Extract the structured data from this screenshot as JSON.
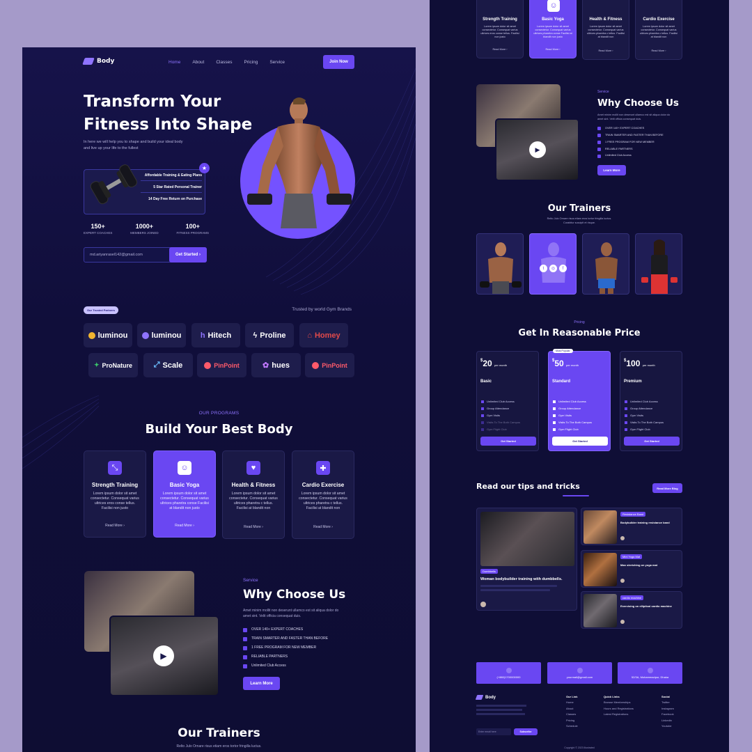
{
  "brand": {
    "name": "Body"
  },
  "nav": {
    "items": [
      "Home",
      "About",
      "Classes",
      "Pricing",
      "Service"
    ],
    "cta": "Join Now"
  },
  "hero": {
    "title_line1": "Transform Your",
    "title_line2": "Fitness Into Shape",
    "subtitle_line1": "In here we will help you to shape and build your ideal body",
    "subtitle_line2": "and live up your life to the fullest",
    "features": [
      "Affordable Training & Eating Plans",
      "5 Star Rated Personal Trainer",
      "14 Day Free Return on Purchase"
    ],
    "stats": [
      {
        "value": "150+",
        "label": "EXPERT COACHES"
      },
      {
        "value": "1000+",
        "label": "MEMBERS JOINED"
      },
      {
        "value": "100+",
        "label": "FITNESS PROGRAMS"
      }
    ],
    "email_value": "md.ariyanrasel142@gmail.com",
    "cta": "Get Started"
  },
  "trusted": {
    "badge": "Our Trusted Partners",
    "text": "Trusted by world Gym Brands",
    "brands_row1": [
      "luminou",
      "luminou",
      "Hitech",
      "Proline",
      "Homey"
    ],
    "brands_row2": [
      "ProNature",
      "Scale",
      "PinPoint",
      "hues",
      "PinPoint"
    ]
  },
  "programs": {
    "eyebrow": "OUR PROGRAMS",
    "title": "Build Your Best Body",
    "cards": [
      {
        "title": "Strength Training",
        "desc": "Lorem ipsum dolor sit amet consectetur. Consequat varius ultrices eros conse tellus. Facilisi non justo",
        "more": "Read More"
      },
      {
        "title": "Basic Yoga",
        "desc": "Lorem ipsum dolor sit amet consectetur. Consequat varius ultrices pharetra conse Facilisi at blandit non justo",
        "more": "Read More"
      },
      {
        "title": "Health & Fitness",
        "desc": "Lorem ipsum dolor sit amet consectetur. Consequat varius ultrices pharetra c tellus. Facilisi at blandit non",
        "more": "Read More"
      },
      {
        "title": "Cardio Exercise",
        "desc": "Lorem ipsum dolor sit amet consectetur. Consequat varius ultrices pharetra c tellus. Facilisi at blandit non",
        "more": "Read More"
      }
    ]
  },
  "why": {
    "eyebrow": "Service",
    "title": "Why Choose Us",
    "desc_line1": "Amet minim mollit non deserunt ullamco est sit aliqua dolor do",
    "desc_line2": "amet sint. Velit officia consequat duis.",
    "points": [
      "OVER 140+ EXPERT COACHES",
      "TRAIN SMARTER AND FASTER THAN BEFORE",
      "1 FREE PROGRAM FOR NEW MEMBER",
      "RELIABLE PARTNERS",
      "Unlimited Club Access"
    ],
    "cta": "Learn More"
  },
  "trainers": {
    "title": "Our Trainers",
    "desc_line1": "Relto Julo Ornare risus etiam eros tortor fringilla luctus.",
    "desc_line2": "Curabitur suscipit et risque."
  },
  "pricing": {
    "eyebrow": "Pricing",
    "title": "Get In Reasonable Price",
    "popular": "Most Popular",
    "plans": [
      {
        "price": "20",
        "per": "per month",
        "name": "Basic",
        "features": [
          "Unlimited Club Access",
          "Group Attendance",
          "Gym Visits",
          "Visits To The Both Campus",
          "Gym Flight Club"
        ],
        "cta": "Get Started"
      },
      {
        "price": "50",
        "per": "per month",
        "name": "Standard",
        "features": [
          "Unlimited Club Access",
          "Group Attendance",
          "Gym Visits",
          "Visits To The Both Campus",
          "Gym Flight Club"
        ],
        "cta": "Get Started"
      },
      {
        "price": "100",
        "per": "per month",
        "name": "Premium",
        "features": [
          "Unlimited Club Access",
          "Group Attendance",
          "Gym Visits",
          "Visits To The Both Campus",
          "Gym Flight Club"
        ],
        "cta": "Get Started"
      }
    ]
  },
  "tips": {
    "title": "Read our tips and tricks",
    "cta": "Read More Blog",
    "main": {
      "tag": "Dumbbells",
      "title": "Woman bodybuilder training with dumbbells."
    },
    "side": [
      {
        "tag": "Resistance Band",
        "title": "Bodybuilder training resistance band"
      },
      {
        "tag": "Mini Yoga Mat",
        "title": "Man stretching on yoga mat"
      },
      {
        "tag": "cardio machine",
        "title": "Exercising on elliptical cardio machine"
      }
    ]
  },
  "contact": {
    "phone": "(+880)1700000000",
    "email": "yourmail@gmail.com",
    "address": "52/3A, Mohammadpur, Dhaka"
  },
  "footer": {
    "brand": "Body",
    "links_title": "Our Link",
    "links": [
      "Home",
      "About",
      "Classes",
      "Pricing",
      "Schedule"
    ],
    "quick_title": "Quick Links",
    "quick": [
      "Browse Memberships",
      "Hours and Registrations",
      "Latest Registrations"
    ],
    "social_title": "Social",
    "social": [
      "Twitter",
      "Instagram",
      "Facebook",
      "Linkedin",
      "Youtube"
    ],
    "email_placeholder": "Enter email here",
    "subscribe": "Subscribe",
    "copyright": "Copyright © 2023 Illustrated"
  },
  "colors": {
    "accent": "#6a47f2",
    "bg": "#0e0d33",
    "card": "#1a1946",
    "frame": "#a59ac9"
  }
}
